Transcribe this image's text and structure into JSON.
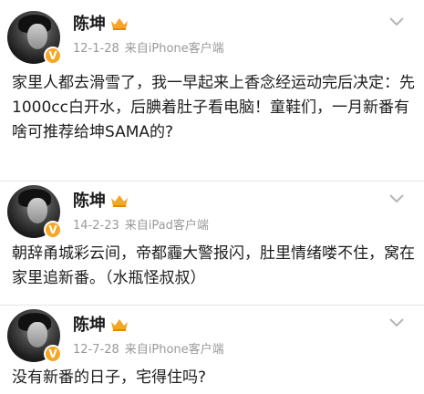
{
  "posts": [
    {
      "author": "陈坤",
      "time": "12-1-28",
      "source": "来自iPhone客户端",
      "text": "家里人都去滑雪了，我一早起来上香念经运动完后决定：先1000cc白开水，后腆着肚子看电脑！童鞋们，一月新番有啥可推荐给坤SAMA的?"
    },
    {
      "author": "陈坤",
      "time": "14-2-23",
      "source": "来自iPad客户端",
      "text": "朝辞甬城彩云间，帝都霾大警报闪，肚里情绪喽不住，窝在家里追新番。（水瓶怪叔叔）"
    },
    {
      "author": "陈坤",
      "time": "12-7-28",
      "source": "来自iPhone客户端",
      "text": "没有新番的日子，宅得住吗?"
    }
  ],
  "verified_badge": "V",
  "colors": {
    "badge": "#f5a623",
    "meta": "#9a9a9a",
    "text": "#1d1d1d"
  }
}
